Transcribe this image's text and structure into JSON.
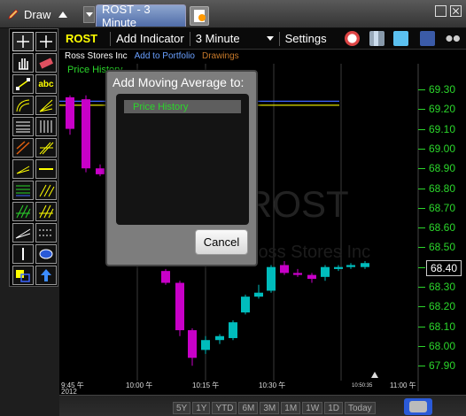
{
  "toolbar": {
    "draw_label": "Draw",
    "tab_title": "ROST - 3 Minute"
  },
  "menubar": {
    "symbol": "ROST",
    "add_indicator": "Add Indicator",
    "interval": "3 Minute",
    "settings": "Settings",
    "icons": [
      "alarm-clock-icon",
      "books-icon",
      "twitter-icon",
      "facebook-icon",
      "binoculars-icon"
    ]
  },
  "subbar": {
    "company": "Ross Stores Inc",
    "add_to_portfolio": "Add to Portfolio",
    "drawings": "Drawings"
  },
  "chart": {
    "price_history_label": "Price History",
    "watermark_symbol": "ROST",
    "watermark_company": "Ross Stores Inc",
    "current_price": "68.40",
    "date_label": "2012",
    "timestamp": "10:50:35",
    "colors": {
      "up": "#00bcbc",
      "down": "#c800c8",
      "axis": "#2bd62b",
      "ma_yellow": "#e0e000",
      "ma_blue": "#3c64ff"
    }
  },
  "chart_data": {
    "type": "candlestick",
    "y_ticks": [
      "69.30",
      "69.20",
      "69.10",
      "69.00",
      "68.90",
      "68.80",
      "68.70",
      "68.60",
      "68.50",
      "68.40",
      "68.30",
      "68.20",
      "68.10",
      "68.00",
      "67.90"
    ],
    "x_ticks": [
      "9:45 午",
      "10:00 午",
      "10:15 午",
      "10:30 午",
      "11:00 午"
    ],
    "ylim": [
      67.88,
      69.34
    ],
    "candles": [
      {
        "o": 69.26,
        "h": 69.27,
        "l": 69.07,
        "c": 69.1
      },
      {
        "o": 69.25,
        "h": 69.27,
        "l": 68.88,
        "c": 68.9
      },
      {
        "o": 68.9,
        "h": 68.92,
        "l": 68.86,
        "c": 68.87
      },
      {
        "o": 68.38,
        "h": 68.39,
        "l": 68.31,
        "c": 68.32
      },
      {
        "o": 68.32,
        "h": 68.33,
        "l": 68.05,
        "c": 68.08
      },
      {
        "o": 68.08,
        "h": 68.09,
        "l": 67.9,
        "c": 67.94
      },
      {
        "o": 67.98,
        "h": 68.05,
        "l": 67.96,
        "c": 68.03
      },
      {
        "o": 68.03,
        "h": 68.06,
        "l": 68.01,
        "c": 68.05
      },
      {
        "o": 68.04,
        "h": 68.13,
        "l": 68.03,
        "c": 68.12
      },
      {
        "o": 68.17,
        "h": 68.26,
        "l": 68.16,
        "c": 68.25
      },
      {
        "o": 68.25,
        "h": 68.31,
        "l": 68.24,
        "c": 68.27
      },
      {
        "o": 68.28,
        "h": 68.41,
        "l": 68.27,
        "c": 68.4
      },
      {
        "o": 68.41,
        "h": 68.43,
        "l": 68.36,
        "c": 68.37
      },
      {
        "o": 68.37,
        "h": 68.39,
        "l": 68.35,
        "c": 68.36
      },
      {
        "o": 68.36,
        "h": 68.37,
        "l": 68.32,
        "c": 68.34
      },
      {
        "o": 68.35,
        "h": 68.41,
        "l": 68.33,
        "c": 68.4
      },
      {
        "o": 68.39,
        "h": 68.41,
        "l": 68.38,
        "c": 68.4
      },
      {
        "o": 68.4,
        "h": 68.42,
        "l": 68.39,
        "c": 68.41
      },
      {
        "o": 68.4,
        "h": 68.43,
        "l": 68.39,
        "c": 68.42
      }
    ],
    "ma_lines": [
      {
        "color": "#e0e000",
        "value": 69.22
      },
      {
        "color": "#3c64ff",
        "value": 69.24
      }
    ]
  },
  "navigator": {
    "ranges": [
      "5Y",
      "1Y",
      "YTD",
      "6M",
      "3M",
      "1M",
      "1W",
      "1D",
      "Today"
    ]
  },
  "modal": {
    "title": "Add Moving Average to:",
    "item": "Price History",
    "cancel": "Cancel"
  }
}
